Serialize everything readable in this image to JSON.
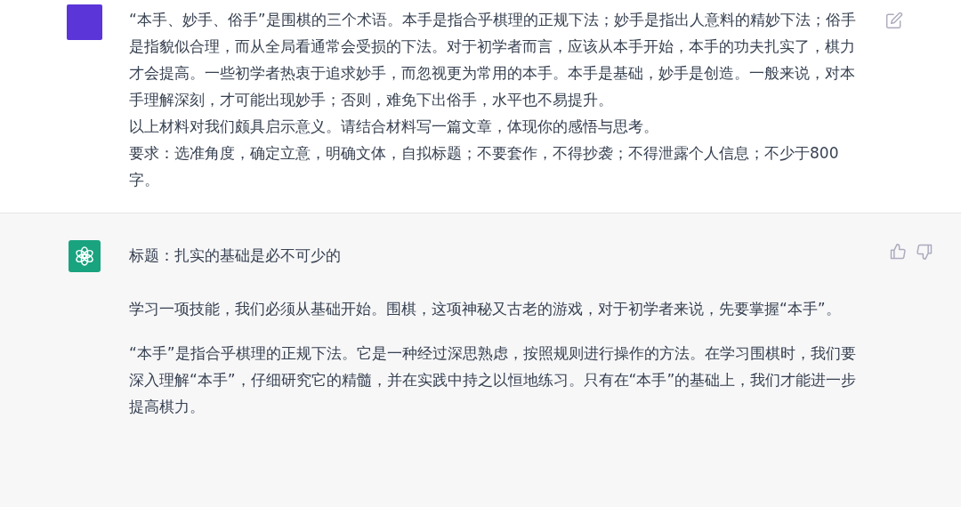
{
  "user_message": {
    "paragraphs": [
      "“本手、妙手、俗手”是围棋的三个术语。本手是指合乎棋理的正规下法；妙手是指出人意料的精妙下法；俗手是指貌似合理，而从全局看通常会受损的下法。对于初学者而言，应该从本手开始，本手的功夫扎实了，棋力才会提高。一些初学者热衷于追求妙手，而忽视更为常用的本手。本手是基础，妙手是创造。一般来说，对本手理解深刻，才可能出现妙手；否则，难免下出俗手，水平也不易提升。",
      "以上材料对我们颇具启示意义。请结合材料写一篇文章，体现你的感悟与思考。",
      "要求：选准角度，确定立意，明确文体，自拟标题；不要套作，不得抄袭；不得泄露个人信息；不少于800字。"
    ]
  },
  "assistant_message": {
    "paragraphs": [
      "标题：扎实的基础是必不可少的",
      "学习一项技能，我们必须从基础开始。围棋，这项神秘又古老的游戏，对于初学者来说，先要掌握“本手”。",
      "“本手”是指合乎棋理的正规下法。它是一种经过深思熟虑，按照规则进行操作的方法。在学习围棋时，我们要深入理解“本手”，仔细研究它的精髓，并在实践中持之以恒地练习。只有在“本手”的基础上，我们才能进一步提高棋力。"
    ]
  }
}
